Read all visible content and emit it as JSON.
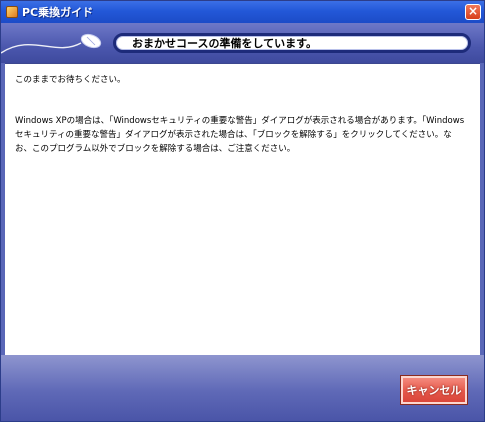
{
  "window": {
    "title": "PC乗換ガイド",
    "close_label": "×"
  },
  "header": {
    "title": "おまかせコースの準備をしています。"
  },
  "content": {
    "message1": "このままでお待ちください。",
    "message2": "Windows XPの場合は、「Windowsセキュリティの重要な警告」ダイアログが表示される場合があります。「Windowsセキュリティの重要な警告」ダイアログが表示された場合は、「ブロックを解除する」をクリックしてください。なお、このプログラム以外でブロックを解除する場合は、ご注意ください。"
  },
  "footer": {
    "cancel_label": "キャンセル"
  },
  "colors": {
    "titlebar": "#2358d8",
    "header_band": "#4b57ad",
    "cancel_button": "#e5584a",
    "content_bg": "#ffffff"
  }
}
